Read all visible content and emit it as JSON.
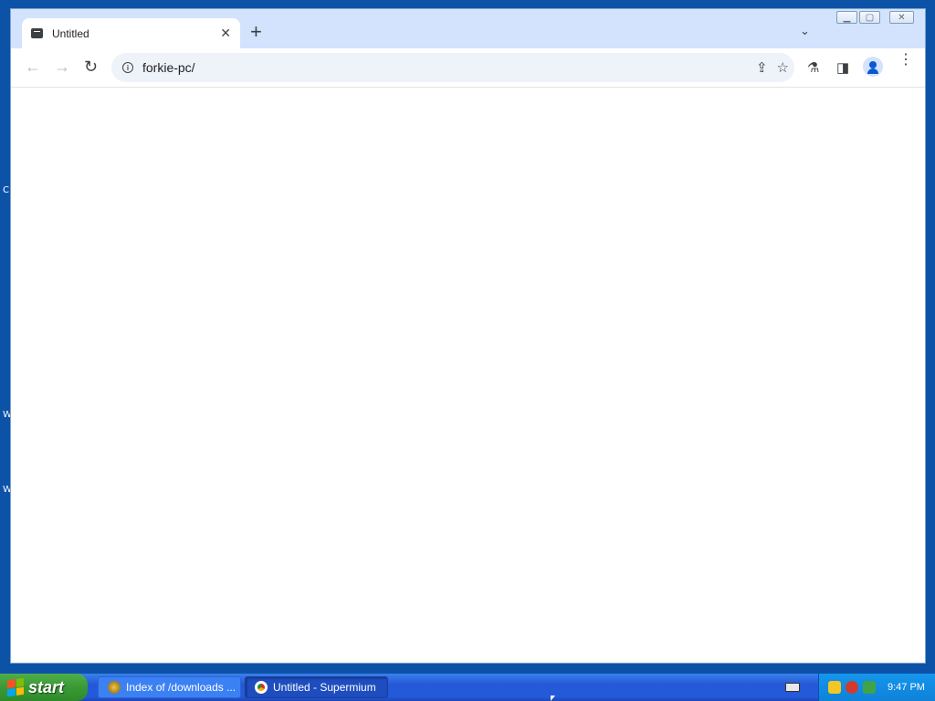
{
  "browser": {
    "tab": {
      "title": "Untitled",
      "close_glyph": "✕"
    },
    "new_tab_glyph": "+",
    "tab_search_glyph": "⌄",
    "window_controls": {
      "minimize": "▁",
      "maximize": "▢",
      "close": "✕"
    },
    "toolbar": {
      "back_glyph": "←",
      "forward_glyph": "→",
      "reload_glyph": "↻",
      "address": "forkie-pc/",
      "share_glyph": "⇪",
      "bookmark_glyph": "☆",
      "labs_glyph": "⚗",
      "sidepanel_glyph": "◨",
      "menu_glyph": "⋮"
    }
  },
  "desktop": {
    "edge_letters": [
      "C",
      "W",
      "W"
    ]
  },
  "taskbar": {
    "start_label": "start",
    "tasks": [
      {
        "label": "Index of /downloads ...",
        "active": false
      },
      {
        "label": "Untitled - Supermium",
        "active": true
      }
    ],
    "clock": "9:47 PM"
  },
  "colors": {
    "desktop": "#0c53a8",
    "tab_strip": "#d3e3fd",
    "taskbar": "#245ad8",
    "start_button": "#3a9a35",
    "tray": "#0f81d8"
  }
}
